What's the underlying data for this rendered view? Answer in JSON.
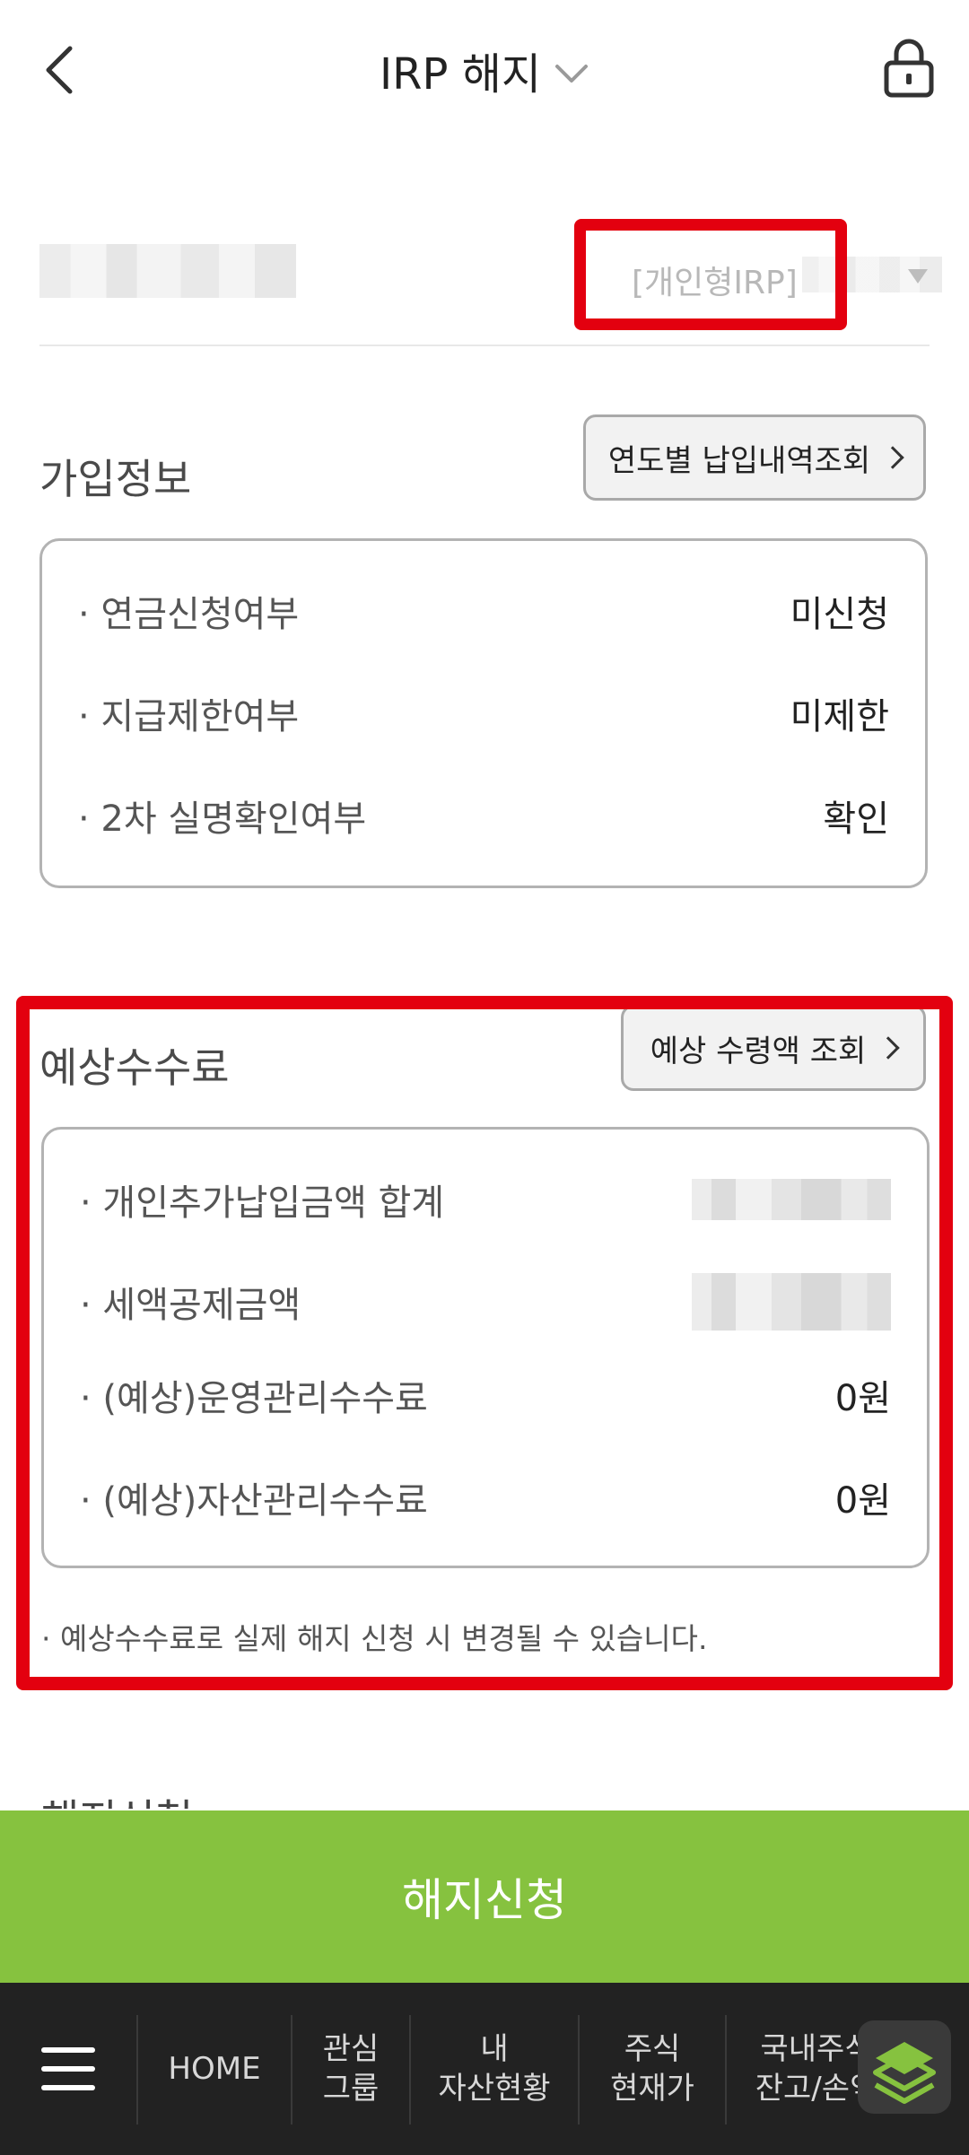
{
  "header": {
    "title": "IRP 해지"
  },
  "account": {
    "type_label": "[개인형IRP]"
  },
  "join_info": {
    "title": "가입정보",
    "button_label": "연도별 납입내역조회",
    "rows": [
      {
        "label": "· 연금신청여부",
        "value": "미신청"
      },
      {
        "label": "· 지급제한여부",
        "value": "미제한"
      },
      {
        "label": "· 2차 실명확인여부",
        "value": "확인"
      }
    ]
  },
  "fees": {
    "title": "예상수수료",
    "button_label": "예상 수령액 조회",
    "rows": [
      {
        "label": "· 개인추가납입금액 합계"
      },
      {
        "label": "· 세액공제금액"
      },
      {
        "label": "· (예상)운영관리수수료",
        "value": "0원"
      },
      {
        "label": "· (예상)자산관리수수료",
        "value": "0원"
      }
    ],
    "note": "· 예상수수료로 실제 해지 신청 시 변경될 수 있습니다."
  },
  "next_section_peek": "해지신청",
  "cta": {
    "label": "해지신청"
  },
  "bottom_nav": {
    "items": [
      {
        "label": "HOME"
      },
      {
        "label": "관심\n그룹"
      },
      {
        "label": "내\n자산현황"
      },
      {
        "label": "주식\n현재가"
      },
      {
        "label": "국내주식\n잔고/손익"
      }
    ]
  },
  "colors": {
    "accent_green": "#86c23f",
    "highlight_red": "#e3000f",
    "nav_bg": "#222222"
  }
}
